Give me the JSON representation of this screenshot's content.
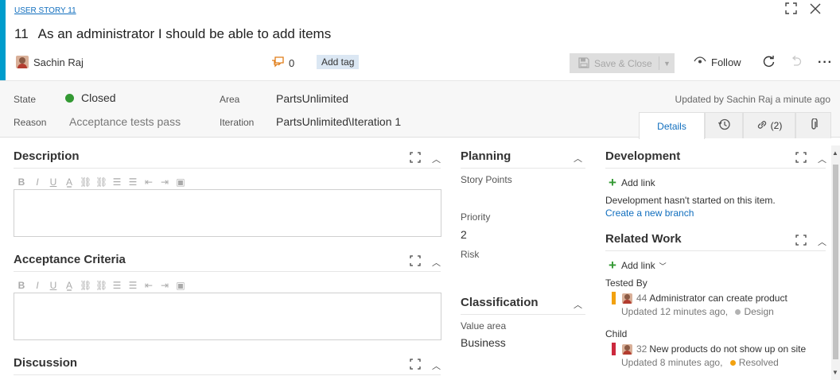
{
  "header": {
    "type_label": "USER STORY 11",
    "id": "11",
    "title": "As an administrator I should be able to add items",
    "assignee": "Sachin Raj",
    "comment_count": "0",
    "add_tag_label": "Add tag",
    "save_close_label": "Save & Close",
    "follow_label": "Follow",
    "icons": [
      "maximize-icon",
      "close-icon",
      "comment-icon",
      "save-icon",
      "eye-icon",
      "refresh-icon",
      "undo-icon",
      "more-icon"
    ]
  },
  "fields": {
    "state_label": "State",
    "state_value": "Closed",
    "state_color": "#339933",
    "reason_label": "Reason",
    "reason_value": "Acceptance tests pass",
    "area_label": "Area",
    "area_value": "PartsUnlimited",
    "iteration_label": "Iteration",
    "iteration_value": "PartsUnlimited\\Iteration 1",
    "updated_text": "Updated by Sachin Raj a minute ago"
  },
  "tabs": {
    "details": "Details",
    "history_icon": "history-icon",
    "links_count": "(2)",
    "attachment_icon": "paperclip-icon"
  },
  "left": {
    "description_title": "Description",
    "acceptance_title": "Acceptance Criteria",
    "discussion_title": "Discussion",
    "toolbar_icons": [
      "bold",
      "italic",
      "underline",
      "highlight",
      "link",
      "unlink",
      "bullets",
      "numbering",
      "outdent",
      "indent",
      "image"
    ]
  },
  "planning": {
    "title": "Planning",
    "story_points_label": "Story Points",
    "story_points_value": "",
    "priority_label": "Priority",
    "priority_value": "2",
    "risk_label": "Risk",
    "risk_value": "",
    "classification_title": "Classification",
    "value_area_label": "Value area",
    "value_area_value": "Business"
  },
  "development": {
    "title": "Development",
    "add_link": "Add link",
    "message": "Development hasn't started on this item.",
    "create_branch": "Create a new branch"
  },
  "related_work": {
    "title": "Related Work",
    "add_link": "Add link",
    "groups": [
      {
        "label": "Tested By",
        "item_id": "44",
        "item_title": "Administrator can create product",
        "updated": "Updated 12 minutes ago,",
        "status": "Design",
        "bar_color": "#f2a10f",
        "status_color": "#b2b2b2"
      },
      {
        "label": "Child",
        "item_id": "32",
        "item_title": "New products do not show up on site",
        "updated": "Updated 8 minutes ago,",
        "status": "Resolved",
        "bar_color": "#cc293d",
        "status_color": "#f2a10f"
      }
    ]
  }
}
